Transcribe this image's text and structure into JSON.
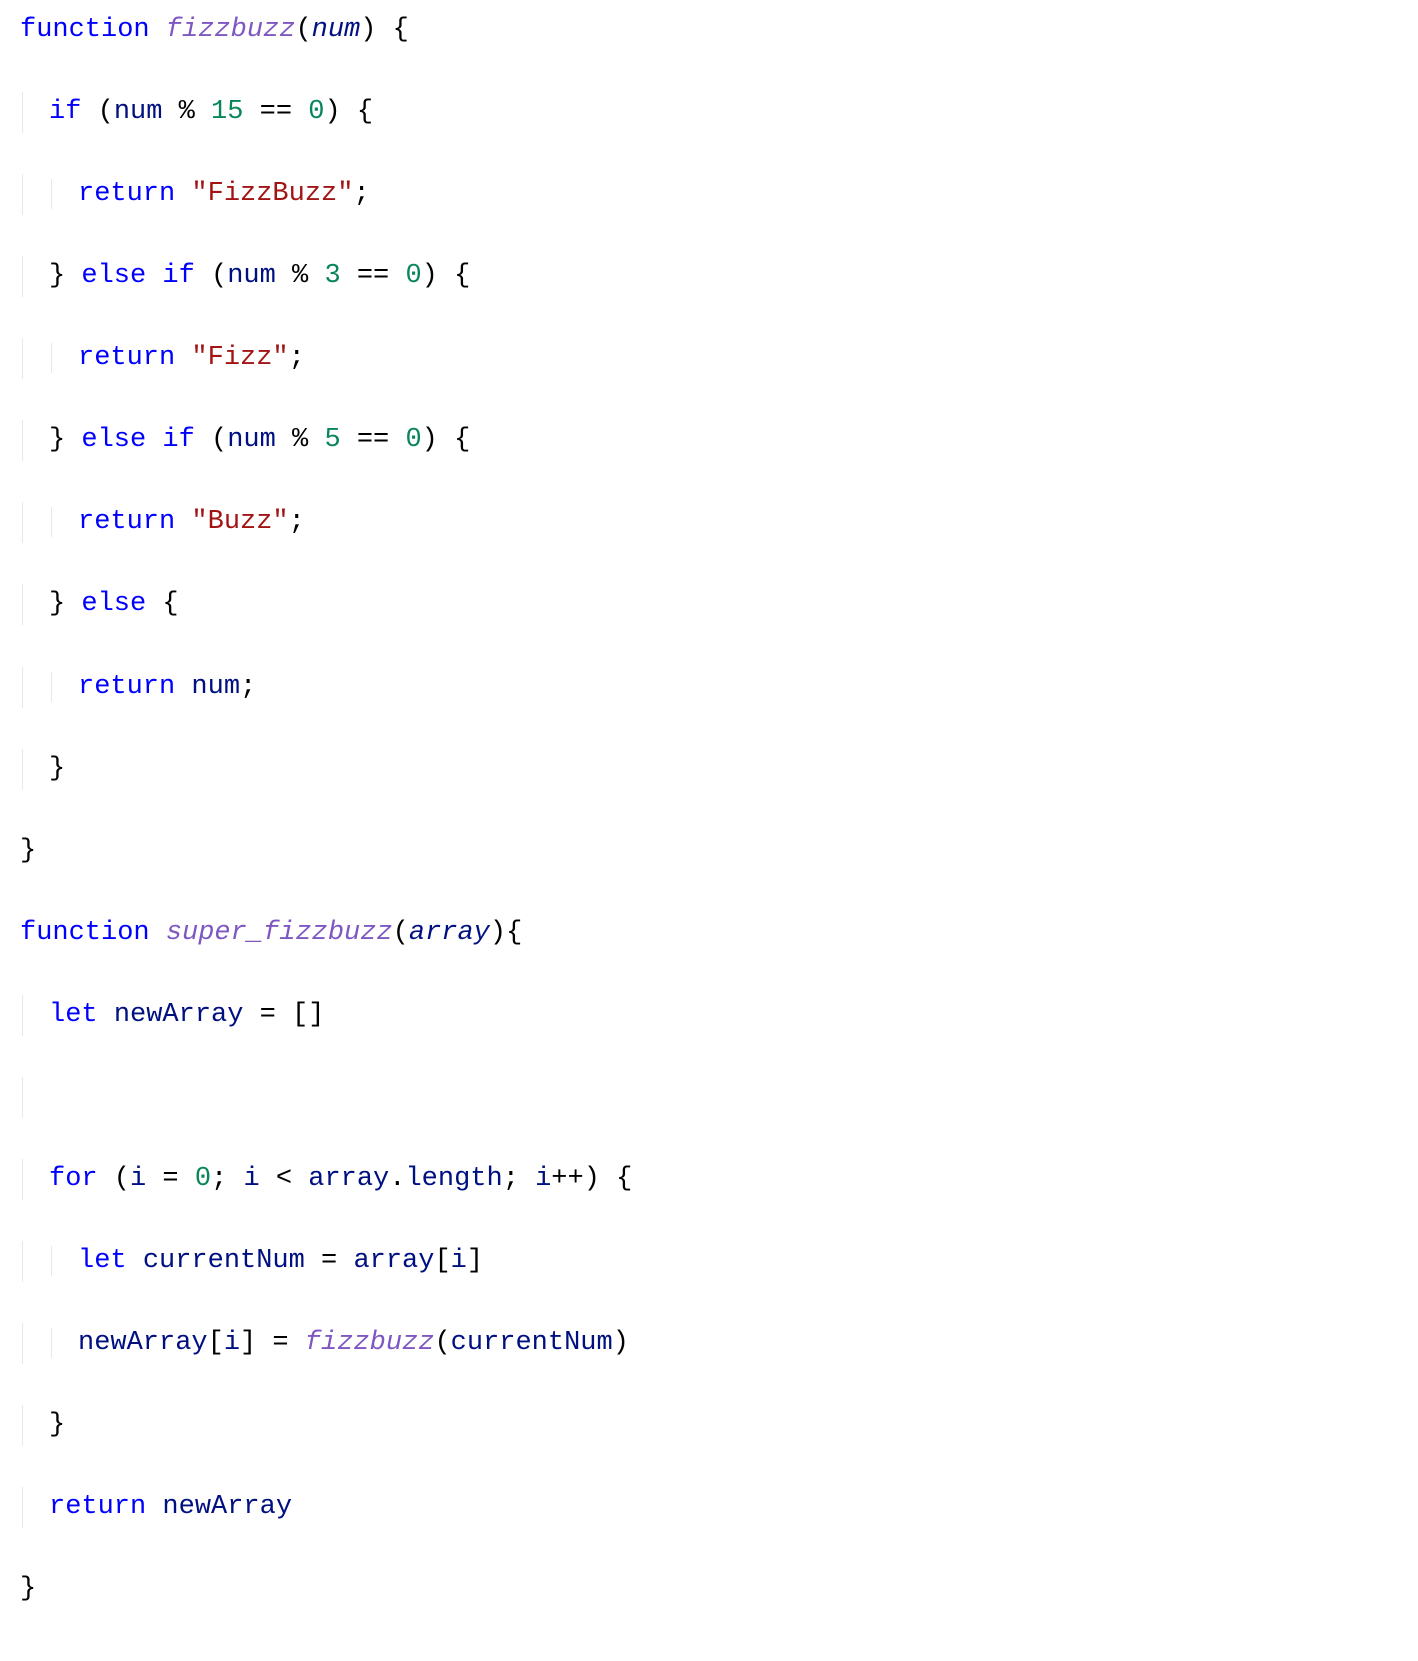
{
  "code": {
    "line1": {
      "kw_function": "function",
      "fn_name": "fizzbuzz",
      "open_paren": "(",
      "param": "num",
      "close_paren": ")",
      "open_brace": " {"
    },
    "line2": {
      "kw_if": "if",
      "open_paren": " (",
      "var_num": "num",
      "mod": " % ",
      "lit_15": "15",
      "eq": " == ",
      "lit_0": "0",
      "close": ") {"
    },
    "line3": {
      "kw_return": "return",
      "sp": " ",
      "str": "\"FizzBuzz\"",
      "semi": ";"
    },
    "line4": {
      "close_brace": "}",
      "sp": " ",
      "kw_else": "else",
      "sp2": " ",
      "kw_if": "if",
      "open": " (",
      "var_num": "num",
      "mod": " % ",
      "lit_3": "3",
      "eq": " == ",
      "lit_0": "0",
      "close": ") {"
    },
    "line5": {
      "kw_return": "return",
      "sp": " ",
      "str": "\"Fizz\"",
      "semi": ";"
    },
    "line6": {
      "close_brace": "}",
      "sp": " ",
      "kw_else": "else",
      "sp2": " ",
      "kw_if": "if",
      "open": " (",
      "var_num": "num",
      "mod": " % ",
      "lit_5": "5",
      "eq": " == ",
      "lit_0": "0",
      "close": ") {"
    },
    "line7": {
      "kw_return": "return",
      "sp": " ",
      "str": "\"Buzz\"",
      "semi": ";"
    },
    "line8": {
      "close_brace": "}",
      "sp": " ",
      "kw_else": "else",
      "open": " {"
    },
    "line9": {
      "kw_return": "return",
      "sp": " ",
      "var_num": "num",
      "semi": ";"
    },
    "line10": {
      "close_brace": "}"
    },
    "line11": {
      "close_brace": "}"
    },
    "line12": {
      "kw_function": "function",
      "fn_name": "super_fizzbuzz",
      "open_paren": "(",
      "param": "array",
      "close_paren": ")",
      "open_brace": "{"
    },
    "line13": {
      "kw_let": "let",
      "sp": " ",
      "var": "newArray",
      "eq": " = ",
      "brackets": "[]"
    },
    "line14_blank": "",
    "line15": {
      "kw_for": "for",
      "open": " (",
      "var_i": "i",
      "eq": " = ",
      "lit_0": "0",
      "semi1": "; ",
      "var_i2": "i",
      "lt": " < ",
      "var_arr": "array",
      "dot": ".",
      "prop_len": "length",
      "semi2": "; ",
      "var_i3": "i",
      "inc": "++",
      "close": ") {"
    },
    "line16": {
      "kw_let": "let",
      "sp": " ",
      "var": "currentNum",
      "eq": " = ",
      "arr": "array",
      "br_open": "[",
      "idx": "i",
      "br_close": "]"
    },
    "line17": {
      "var_new": "newArray",
      "br_open": "[",
      "idx": "i",
      "br_close": "]",
      "eq": " = ",
      "fn": "fizzbuzz",
      "open": "(",
      "arg": "currentNum",
      "close": ")"
    },
    "line18": {
      "close_brace": "}"
    },
    "line19": {
      "kw_return": "return",
      "sp": " ",
      "var": "newArray"
    },
    "line20": {
      "close_brace": "}"
    }
  }
}
